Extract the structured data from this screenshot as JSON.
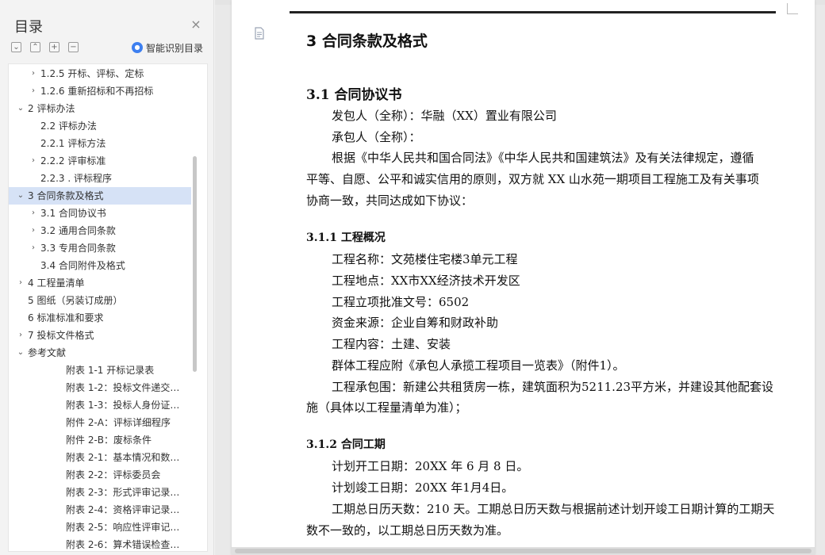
{
  "sidebar": {
    "title": "目录",
    "close_icon": "close-icon",
    "tools": [
      "collapse-all-icon",
      "expand-all-icon",
      "add-heading-icon",
      "remove-heading-icon"
    ],
    "smart_label": "智能识别目录",
    "smart_icon": "robot-icon",
    "toc": [
      {
        "label": "1.2.5 开标、评标、定标",
        "arrow": "›",
        "level": 2
      },
      {
        "label": "1.2.6 重新招标和不再招标",
        "arrow": "›",
        "level": 2
      },
      {
        "label": "2 评标办法",
        "arrow": "⌄",
        "level": 1
      },
      {
        "label": "2.2 评标办法",
        "arrow": "",
        "level": 2
      },
      {
        "label": "2.2.1 评标方法",
        "arrow": "",
        "level": 2
      },
      {
        "label": "2.2.2 评审标准",
        "arrow": "›",
        "level": 2
      },
      {
        "label": "2.2.3 . 评标程序",
        "arrow": "",
        "level": 2
      },
      {
        "label": "3 合同条款及格式",
        "arrow": "⌄",
        "level": 1,
        "selected": true
      },
      {
        "label": "3.1  合同协议书",
        "arrow": "›",
        "level": 2
      },
      {
        "label": "3.2  通用合同条款",
        "arrow": "›",
        "level": 2
      },
      {
        "label": "3.3  专用合同条款",
        "arrow": "›",
        "level": 2
      },
      {
        "label": "3.4  合同附件及格式",
        "arrow": "",
        "level": 2
      },
      {
        "label": "4 工程量清单",
        "arrow": "›",
        "level": 1
      },
      {
        "label": "5 图纸（另装订成册）",
        "arrow": "",
        "level": 1
      },
      {
        "label": "6  标准标准和要求",
        "arrow": "",
        "level": 1
      },
      {
        "label": "7 投标文件格式",
        "arrow": "›",
        "level": 1
      },
      {
        "label": "参考文献",
        "arrow": "⌄",
        "level": 1
      },
      {
        "label": "附表 1-1  开标记录表",
        "arrow": "",
        "level": 3
      },
      {
        "label": "附表 1-2：投标文件递交…",
        "arrow": "",
        "level": 3
      },
      {
        "label": "附表 1-3：投标人身份证…",
        "arrow": "",
        "level": 3
      },
      {
        "label": "附件 2-A：评标详细程序",
        "arrow": "",
        "level": 3
      },
      {
        "label": "附件 2-B：废标条件",
        "arrow": "",
        "level": 3
      },
      {
        "label": "附表 2-1：基本情况和数…",
        "arrow": "",
        "level": 3
      },
      {
        "label": "附表 2-2：评标委员会",
        "arrow": "",
        "level": 3
      },
      {
        "label": "附表 2-3：形式评审记录…",
        "arrow": "",
        "level": 3
      },
      {
        "label": "附表 2-4：资格评审记录…",
        "arrow": "",
        "level": 3
      },
      {
        "label": "附表 2-5：响应性评审记…",
        "arrow": "",
        "level": 3
      },
      {
        "label": "附表 2-6：算术错误检查…",
        "arrow": "",
        "level": 3
      }
    ]
  },
  "document": {
    "page_icon": "document-icon",
    "heading1": "3 合同条款及格式",
    "heading2": "3.1  合同协议书",
    "employer": "发包人（全称）：华融（XX）置业有限公司",
    "contractor": "承包人（全称）：",
    "agreement_lines": [
      "根据《中华人民共和国合同法》《中华人民共和国建筑法》及有关法律规定，遵循",
      "平等、自愿、公平和诚实信用的原则，双方就 XX 山水苑一期项目工程施工及有关事项",
      "协商一致，共同达成如下协议："
    ],
    "section_311": "3.1.1 工程概况",
    "overview_lines": [
      "工程名称：文苑楼住宅楼3单元工程",
      "工程地点：XX市XX经济技术开发区",
      "工程立项批准文号：6502",
      "资金来源：企业自筹和财政补助",
      "工程内容：土建、安装",
      "群体工程应附《承包人承揽工程项目一览表》（附件1）。"
    ],
    "scope_lines": [
      "工程承包围：新建公共租赁房一栋，建筑面积为5211.23平方米，并建设其他配套设",
      "施（具体以工程量清单为准）；"
    ],
    "section_312": "3.1.2 合同工期",
    "schedule_lines": [
      "计划开工日期：20XX 年 6 月 8 日。",
      "计划竣工日期：20XX  年1月4日。"
    ],
    "duration_lines": [
      "工期总日历天数：210 天。工期总日历天数与根据前述计划开竣工日期计算的工期天",
      "数不一致的，以工期总日历天数为准。"
    ]
  }
}
